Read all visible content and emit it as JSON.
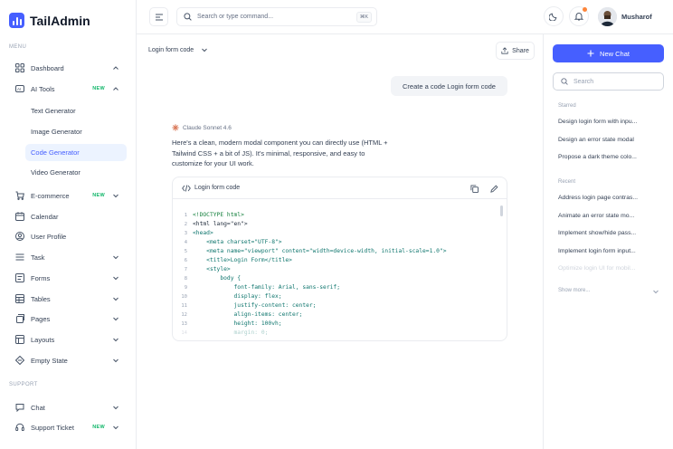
{
  "app": {
    "name": "TailAdmin"
  },
  "sidebar": {
    "menu_label": "MENU",
    "support_label": "SUPPORT",
    "items": [
      {
        "label": "Dashboard",
        "icon": "grid-icon",
        "chevron": "up"
      },
      {
        "label": "AI Tools",
        "icon": "ai-icon",
        "badge": "NEW",
        "chevron": "up"
      },
      {
        "label": "E-commerce",
        "icon": "cart-icon",
        "badge": "NEW",
        "chevron": "down"
      },
      {
        "label": "Calendar",
        "icon": "calendar-icon"
      },
      {
        "label": "User Profile",
        "icon": "user-circle-icon"
      },
      {
        "label": "Task",
        "icon": "task-icon",
        "chevron": "down"
      },
      {
        "label": "Forms",
        "icon": "form-icon",
        "chevron": "down"
      },
      {
        "label": "Tables",
        "icon": "table-icon",
        "chevron": "down"
      },
      {
        "label": "Pages",
        "icon": "page-icon",
        "chevron": "down"
      },
      {
        "label": "Layouts",
        "icon": "layout-icon",
        "chevron": "down"
      },
      {
        "label": "Empty State",
        "icon": "empty-state-icon",
        "chevron": "down"
      }
    ],
    "ai_sub_items": [
      "Text Generator",
      "Image Generator",
      "Code Generator",
      "Video Generator"
    ],
    "support_items": [
      {
        "label": "Chat",
        "icon": "chat-icon",
        "chevron": "down"
      },
      {
        "label": "Support Ticket",
        "icon": "headset-icon",
        "badge": "NEW",
        "chevron": "down"
      }
    ],
    "accent_color": "#465fff"
  },
  "topbar": {
    "search_placeholder": "Search or type command...",
    "shortcut": "⌘K",
    "user_name": "Musharof"
  },
  "chat": {
    "title": "Login form code",
    "share_label": "Share",
    "user_message": "Create a code Login form code",
    "model": "Claude Sonnet 4.6",
    "assistant_text": "Here's a clean, modern modal component you can directly use (HTML + Tailwind CSS + a bit of JS). It's minimal, responsive, and easy to customize for your UI work.",
    "code_title": "Login form code",
    "code_lines": [
      "<!DOCTYPE html>",
      "<html lang=\"en\">",
      "<head>",
      "    <meta charset=\"UTF-8\">",
      "    <meta name=\"viewport\" content=\"width=device-width, initial-scale=1.0\">",
      "    <title>Login Form</title>",
      "    <style>",
      "        body {",
      "            font-family: Arial, sans-serif;",
      "            display: flex;",
      "            justify-content: center;",
      "            align-items: center;",
      "            height: 100vh;",
      "            margin: 0;"
    ]
  },
  "right_panel": {
    "new_chat_label": "New Chat",
    "search_placeholder": "Search",
    "starred_label": "Starred",
    "starred": [
      "Design login form with inpu...",
      "Design an error state modal",
      "Propose a dark theme colo..."
    ],
    "recent_label": "Recent",
    "recent": [
      "Address login page contras...",
      "Animate an error state mo...",
      "Implement show/hide pass...",
      "Implement login form input...",
      "Optimize login UI for mobil..."
    ],
    "show_more_label": "Show more..."
  }
}
